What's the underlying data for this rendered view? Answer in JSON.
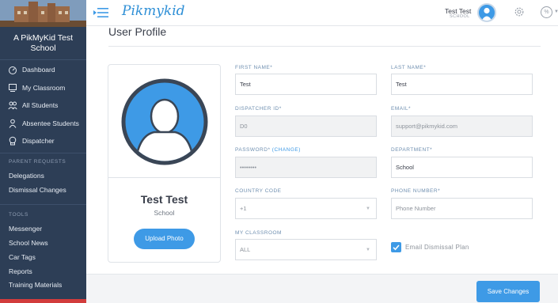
{
  "sidebar": {
    "school_name_line1": "A PikMyKid Test",
    "school_name_line2": "School",
    "nav": [
      {
        "label": "Dashboard",
        "icon": "dashboard-icon"
      },
      {
        "label": "My Classroom",
        "icon": "classroom-icon"
      },
      {
        "label": "All Students",
        "icon": "students-icon"
      },
      {
        "label": "Absentee Students",
        "icon": "absentee-icon"
      },
      {
        "label": "Dispatcher",
        "icon": "dispatcher-icon"
      }
    ],
    "parent_requests_label": "PARENT REQUESTS",
    "parent_requests": [
      "Delegations",
      "Dismissal Changes"
    ],
    "tools_label": "TOOLS",
    "tools": [
      "Messenger",
      "School News",
      "Car Tags",
      "Reports",
      "Training Materials"
    ]
  },
  "header": {
    "logo": "Pikmykid",
    "user_name": "Test Test",
    "user_role": "SCHOOL",
    "percent_symbol": "%"
  },
  "main": {
    "title": "User Profile",
    "card": {
      "name": "Test Test",
      "role": "School",
      "upload_label": "Upload Photo"
    },
    "form": {
      "first_name_label": "FIRST NAME*",
      "first_name_value": "Test",
      "last_name_label": "LAST NAME*",
      "last_name_value": "Test",
      "dispatcher_id_label": "DISPATCHER ID*",
      "dispatcher_id_value": "D0",
      "email_label": "EMAIL*",
      "email_value": "support@pikmykid.com",
      "password_label": "PASSWORD*",
      "password_change": "(CHANGE)",
      "password_value": "••••••••",
      "department_label": "DEPARTMENT*",
      "department_value": "School",
      "country_code_label": "COUNTRY CODE",
      "country_code_value": "+1",
      "phone_label": "PHONE NUMBER*",
      "phone_placeholder": "Phone Number",
      "classroom_label": "MY CLASSROOM",
      "classroom_value": "ALL",
      "email_dismissal_label": "Email Dismissal Plan",
      "email_dismissal_checked": true
    },
    "save_label": "Save Changes"
  },
  "colors": {
    "sidebar_bg": "#2d3e56",
    "accent": "#3e9ae6"
  }
}
